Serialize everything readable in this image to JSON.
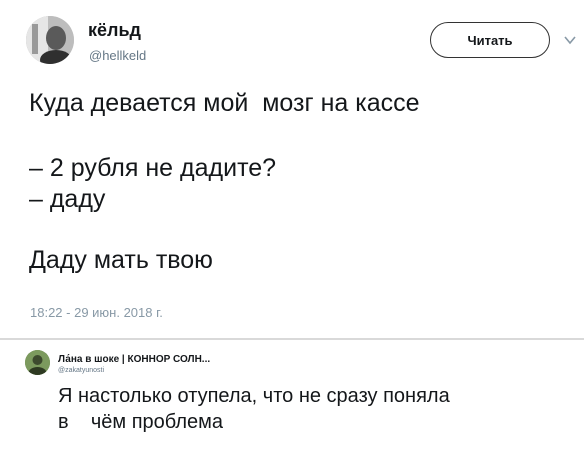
{
  "tweet": {
    "author": {
      "display_name": "кёльд",
      "handle": "@hellkeld"
    },
    "follow_label": "Читать",
    "text_lines": [
      "Куда девается мой  мозг на кассе",
      "– 2 рубля не дадите?",
      "– даду",
      "Даду мать твою"
    ],
    "timestamp": "18:22 - 29 июн. 2018 г."
  },
  "reply": {
    "author": {
      "display_name": "Ла́на в шоке | КОННОР СОЛН...",
      "handle": "@zakatyunosti"
    },
    "text_lines": [
      "Я настолько отупела, что не сразу поняла",
      "в    чём проблема"
    ]
  },
  "colors": {
    "text": "#14171a",
    "secondary": "#657786",
    "divider": "#d9d9d9"
  },
  "icons": [
    "avatar-photo",
    "chevron-down-icon",
    "reply-avatar-photo"
  ]
}
